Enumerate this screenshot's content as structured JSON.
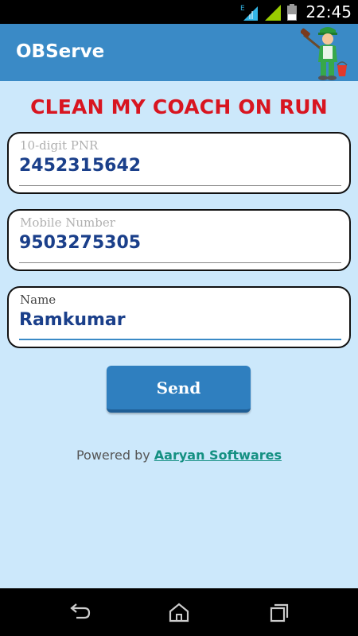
{
  "status_bar": {
    "time": "22:45",
    "network_type": "E",
    "icons": [
      "wifi-icon",
      "signal-icon",
      "battery-icon"
    ]
  },
  "action_bar": {
    "title": "OBServe",
    "logo_icon": "cleaner-mascot-icon"
  },
  "heading": "CLEAN MY COACH ON RUN",
  "form": {
    "pnr": {
      "label": "10-digit PNR",
      "value": "2452315642"
    },
    "mobile": {
      "label": "Mobile Number",
      "value": "9503275305"
    },
    "name": {
      "label": "Name",
      "value": "Ramkumar"
    },
    "send_label": "Send"
  },
  "footer": {
    "powered_by": "Powered by",
    "company_link": "Aaryan Softwares"
  },
  "nav_bar": {
    "buttons": [
      "back-icon",
      "home-icon",
      "recents-icon"
    ]
  },
  "colors": {
    "action_bar": "#3a8ac6",
    "background": "#cce8fb",
    "heading": "#d81520",
    "button": "#2f7fbf",
    "link": "#149082"
  }
}
